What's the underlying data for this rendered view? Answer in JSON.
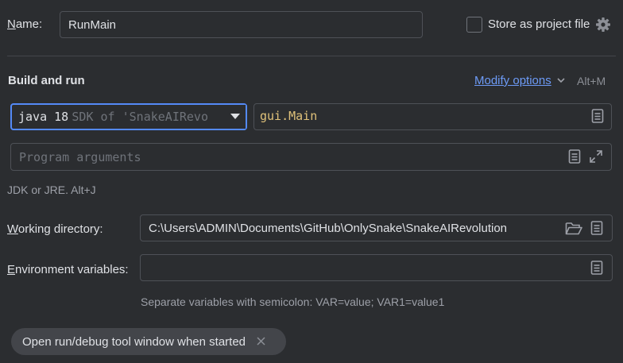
{
  "name": {
    "label_prefix": "",
    "label_mnemonic": "N",
    "label_rest": "ame:",
    "value": "RunMain"
  },
  "store": {
    "label": "Store as project file",
    "checked": false
  },
  "build_run": {
    "heading": "Build and run",
    "modify_label": "Modify options",
    "modify_shortcut": "Alt+M",
    "jdk_version": "java 18",
    "jdk_detail": "SDK of 'SnakeAIRevo",
    "main_class": "gui.Main",
    "program_args_placeholder": "Program arguments",
    "jdk_hint": "JDK or JRE. Alt+J"
  },
  "working_dir": {
    "label_mnemonic": "W",
    "label_rest": "orking directory:",
    "value": "C:\\Users\\ADMIN\\Documents\\GitHub\\OnlySnake\\SnakeAIRevolution"
  },
  "env_vars": {
    "label_mnemonic": "E",
    "label_rest": "nvironment variables:",
    "value": "",
    "hint": "Separate variables with semicolon: VAR=value; VAR1=value1"
  },
  "chip": {
    "label": "Open run/debug tool window when started"
  },
  "colors": {
    "background": "#2b2d30",
    "accent_blue": "#548af7",
    "link_blue": "#6d9bf7",
    "class_yellow": "#e0c27a"
  }
}
